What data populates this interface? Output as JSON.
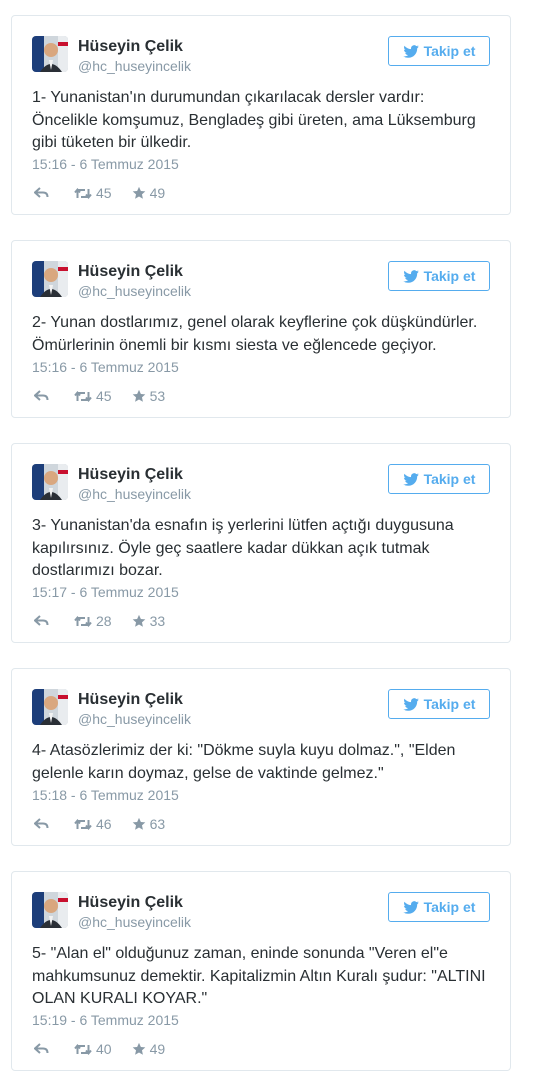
{
  "colors": {
    "accent": "#55acee",
    "text": "#292f33",
    "muted": "#8899a6",
    "border": "#e1e8ed"
  },
  "icons": {
    "follow": "twitter-bird-icon",
    "reply": "reply-icon",
    "retweet": "retweet-icon",
    "favorite": "star-icon"
  },
  "tweets": [
    {
      "author": "Hüseyin Çelik",
      "handle": "@hc_huseyincelik",
      "follow_label": "Takip et",
      "text": "1- Yunanistan'ın durumundan çıkarılacak dersler vardır: Öncelikle komşumuz, Bengladeş gibi üreten, ama Lüksemburg gibi tüketen bir ülkedir.",
      "timestamp": "15:16 - 6 Temmuz 2015",
      "retweets": "45",
      "favorites": "49"
    },
    {
      "author": "Hüseyin Çelik",
      "handle": "@hc_huseyincelik",
      "follow_label": "Takip et",
      "text": "2- Yunan dostlarımız, genel olarak keyflerine çok düşkündürler. Ömürlerinin önemli bir kısmı siesta ve eğlencede geçiyor.",
      "timestamp": "15:16 - 6 Temmuz 2015",
      "retweets": "45",
      "favorites": "53"
    },
    {
      "author": "Hüseyin Çelik",
      "handle": "@hc_huseyincelik",
      "follow_label": "Takip et",
      "text": "3- Yunanistan'da esnafın iş yerlerini lütfen açtığı duygusuna kapılırsınız. Öyle geç saatlere kadar dükkan açık tutmak dostlarımızı bozar.",
      "timestamp": "15:17 - 6 Temmuz 2015",
      "retweets": "28",
      "favorites": "33"
    },
    {
      "author": "Hüseyin Çelik",
      "handle": "@hc_huseyincelik",
      "follow_label": "Takip et",
      "text": "4- Atasözlerimiz der ki: \"Dökme suyla kuyu dolmaz.\", \"Elden gelenle karın doymaz, gelse de vaktinde gelmez.\"",
      "timestamp": "15:18 - 6 Temmuz 2015",
      "retweets": "46",
      "favorites": "63"
    },
    {
      "author": "Hüseyin Çelik",
      "handle": "@hc_huseyincelik",
      "follow_label": "Takip et",
      "text": "5- \"Alan el\" olduğunuz zaman, eninde sonunda \"Veren el\"e mahkumsunuz demektir. Kapitalizmin Altın Kuralı  şudur: \"ALTINI OLAN KURALI KOYAR.\"",
      "timestamp": "15:19 - 6 Temmuz 2015",
      "retweets": "40",
      "favorites": "49"
    }
  ]
}
